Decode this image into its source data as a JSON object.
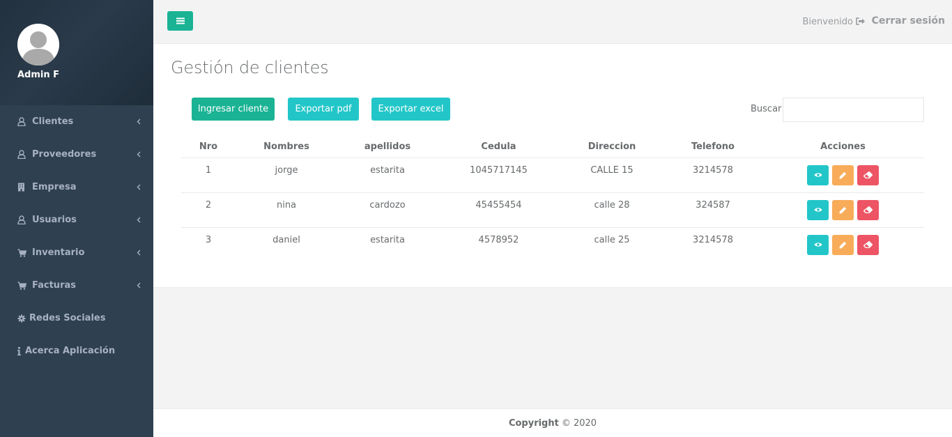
{
  "sidebar": {
    "user_name": "Admin F",
    "items": [
      {
        "label": "Clientes",
        "icon": "user-icon",
        "chevron": true
      },
      {
        "label": "Proveedores",
        "icon": "user-icon",
        "chevron": true
      },
      {
        "label": "Empresa",
        "icon": "building-icon",
        "chevron": true
      },
      {
        "label": "Usuarios",
        "icon": "user-icon",
        "chevron": true
      },
      {
        "label": "Inventario",
        "icon": "cart-icon",
        "chevron": true
      },
      {
        "label": "Facturas",
        "icon": "cart-icon",
        "chevron": true
      },
      {
        "label": "Redes Sociales",
        "icon": "gear-icon",
        "chevron": false
      },
      {
        "label": "Acerca Aplicación",
        "icon": "info-icon",
        "chevron": false
      }
    ]
  },
  "topbar": {
    "welcome": "Bienvenido",
    "logout": "Cerrar sesión"
  },
  "main": {
    "title": "Gestión de clientes",
    "buttons": {
      "add": "Ingresar cliente",
      "pdf": "Exportar pdf",
      "excel": "Exportar excel"
    },
    "search_label": "Buscar",
    "search_value": "",
    "table": {
      "headers": [
        "Nro",
        "Nombres",
        "apellidos",
        "Cedula",
        "Direccion",
        "Telefono",
        "Acciones"
      ],
      "rows": [
        [
          "1",
          "jorge",
          "estarita",
          "1045717145",
          "CALLE 15",
          "3214578"
        ],
        [
          "2",
          "nina",
          "cardozo",
          "45455454",
          "calle 28",
          "324587"
        ],
        [
          "3",
          "daniel",
          "estarita",
          "4578952",
          "calle 25",
          "3214578"
        ]
      ]
    }
  },
  "footer": {
    "copyright_label": "Copyright",
    "copyright_text": "© 2020"
  },
  "colors": {
    "sidebar_bg": "#2f4050",
    "primary": "#1ab394",
    "info": "#23c6c8",
    "warning": "#f8ac59",
    "danger": "#ed5565"
  }
}
